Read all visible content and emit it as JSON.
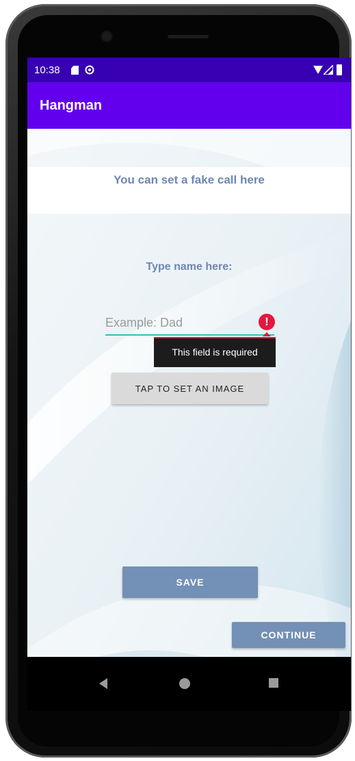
{
  "statusbar": {
    "time": "10:38",
    "icons": [
      "sd-card-icon",
      "sync-icon",
      "wifi-icon",
      "signal-icon",
      "battery-icon"
    ]
  },
  "appbar": {
    "title": "Hangman"
  },
  "banner": {
    "text": "You can set a fake call here"
  },
  "form": {
    "name_label": "Type name here:",
    "name_input": {
      "value": "",
      "placeholder": "Example: Dad"
    },
    "error_message": "This field is required",
    "image_button_label": "TAP TO SET AN IMAGE",
    "save_label": "SAVE",
    "continue_label": "CONTINUE"
  },
  "navbar": {
    "icons": [
      "back-icon",
      "home-icon",
      "recents-icon"
    ]
  },
  "colors": {
    "statusbar": "#3700b3",
    "appbar": "#6200ee",
    "text_accent": "#6e87b0",
    "button_primary": "#7390b6",
    "button_secondary": "#dadada",
    "input_underline": "#2ac3b8",
    "error": "#e5173f"
  }
}
